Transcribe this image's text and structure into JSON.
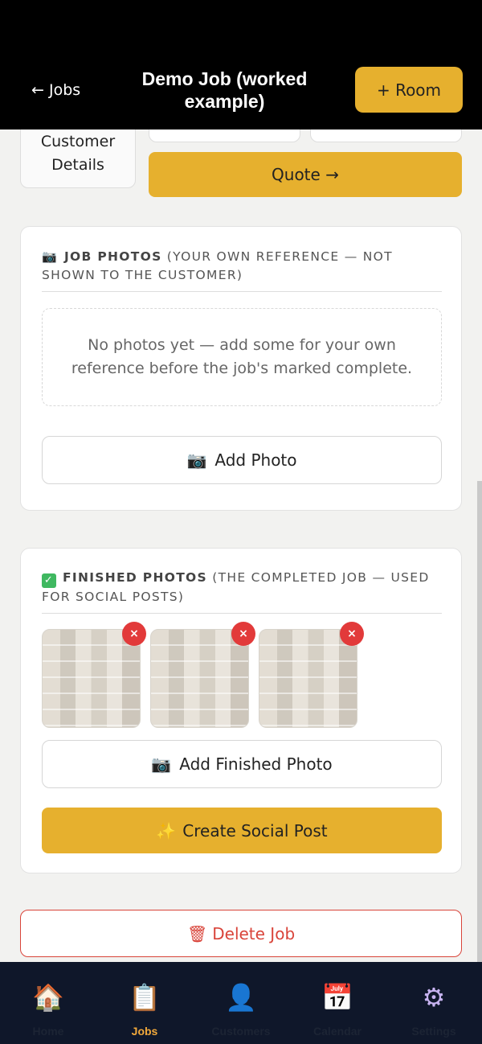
{
  "header": {
    "back_label": "← Jobs",
    "title": "Demo Job (worked example)",
    "add_room_label": "+ Room"
  },
  "top_actions": {
    "customer_details_line1": "Customer",
    "customer_details_line2": "Details",
    "quote_label": "Quote →"
  },
  "job_photos": {
    "icon": "📷",
    "title": "Job Photos",
    "subtitle": "(your own reference — not shown to the customer)",
    "empty_text": "No photos yet — add some for your own reference before the job's marked complete.",
    "add_icon": "📷",
    "add_label": "Add Photo"
  },
  "finished_photos": {
    "icon": "✓",
    "title": "Finished Photos",
    "subtitle": "(the completed job — used for social posts)",
    "remove_glyph": "×",
    "add_icon": "📷",
    "add_label": "Add Finished Photo",
    "social_icon": "✨",
    "social_label": "Create Social Post"
  },
  "delete": {
    "icon": "🗑",
    "label": "Delete Job"
  },
  "nav": {
    "items": [
      {
        "icon": "🏠",
        "label": "Home"
      },
      {
        "icon": "📋",
        "label": "Jobs"
      },
      {
        "icon": "👤",
        "label": "Customers"
      },
      {
        "icon": "📅",
        "label": "Calendar"
      },
      {
        "icon": "⚙",
        "label": "Settings"
      }
    ],
    "active": "Jobs"
  },
  "colors": {
    "accent": "#e6b02e",
    "danger": "#d9443a",
    "nav_bg": "#0f172a",
    "nav_active": "#f2a93b"
  }
}
